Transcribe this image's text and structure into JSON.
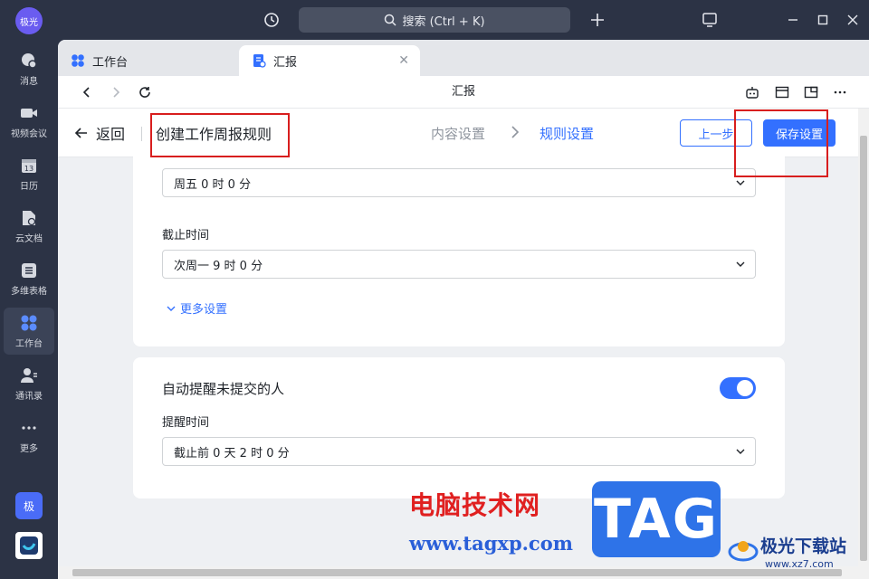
{
  "titlebar": {
    "avatar_text": "极光",
    "search_placeholder": "搜索 (Ctrl + K)"
  },
  "sidebar": {
    "items": [
      {
        "label": "消息",
        "icon": "message-icon"
      },
      {
        "label": "视频会议",
        "icon": "video-icon"
      },
      {
        "label": "日历",
        "icon": "calendar-icon",
        "date": "13"
      },
      {
        "label": "云文档",
        "icon": "document-icon"
      },
      {
        "label": "多维表格",
        "icon": "table-icon"
      },
      {
        "label": "工作台",
        "icon": "workspace-icon",
        "active": true
      },
      {
        "label": "通讯录",
        "icon": "contacts-icon"
      },
      {
        "label": "更多",
        "icon": "more-icon"
      }
    ],
    "app_badge": "极"
  },
  "tabs": [
    {
      "label": "工作台",
      "icon": "workspace-tab-icon"
    },
    {
      "label": "汇报",
      "icon": "report-tab-icon"
    }
  ],
  "navbar": {
    "title": "汇报"
  },
  "header": {
    "back_label": "返回",
    "page_title": "创建工作周报规则",
    "step1": "内容设置",
    "step2": "规则设置",
    "prev_button": "上一步",
    "save_button": "保存设置"
  },
  "card1": {
    "start_value": "周五 0 时 0 分",
    "deadline_label": "截止时间",
    "deadline_value": "次周一 9 时 0 分",
    "more_settings": "更多设置"
  },
  "card2": {
    "title": "自动提醒未提交的人",
    "toggle_on": true,
    "remind_label": "提醒时间",
    "remind_value": "截止前 0 天 2 时 0 分"
  },
  "watermark": {
    "cn_text": "电脑技术网",
    "url": "www.tagxp.com",
    "tag": "TAG",
    "site_name": "极光下载站",
    "site_url": "www.xz7.com"
  },
  "colors": {
    "accent": "#3370ff",
    "sidebar_bg": "#2c3345",
    "highlight": "#d81e1e"
  }
}
